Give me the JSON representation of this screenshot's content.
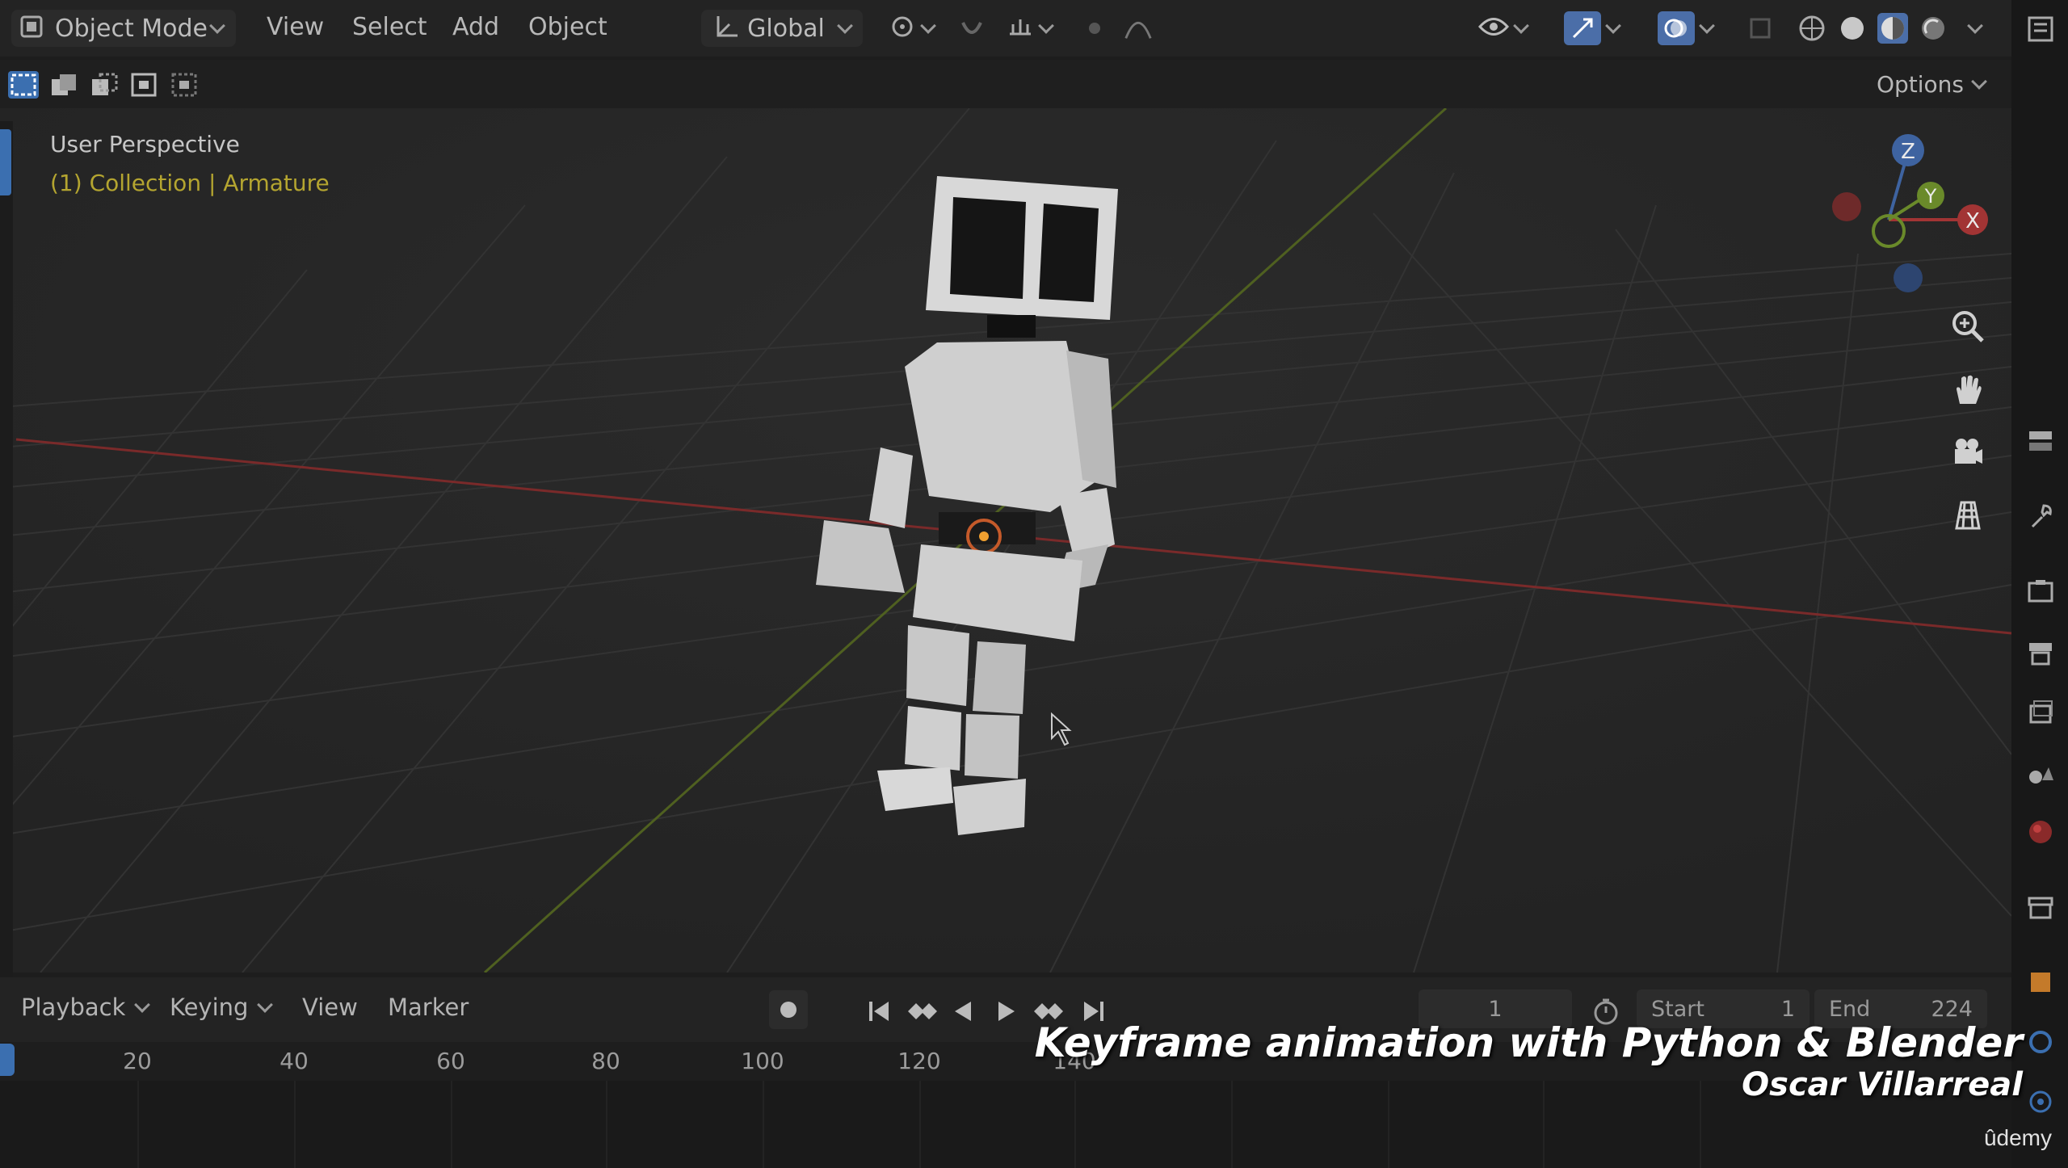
{
  "header": {
    "mode": "Object Mode",
    "menus": [
      "View",
      "Select",
      "Add",
      "Object"
    ],
    "transform_orientation": "Global",
    "options_label": "Options"
  },
  "viewport": {
    "title": "User Perspective",
    "subtitle": "(1) Collection | Armature",
    "gizmo": {
      "x_label": "X",
      "y_label": "Y",
      "z_label": "Z"
    }
  },
  "timeline": {
    "menus": [
      "Playback",
      "Keying",
      "View",
      "Marker"
    ],
    "current_frame": "1",
    "start_label": "Start",
    "start_value": "1",
    "end_label": "End",
    "end_value": "224",
    "ruler_ticks": [
      "20",
      "40",
      "60",
      "80",
      "100",
      "120",
      "140"
    ]
  },
  "overlay": {
    "course_title": "Keyframe animation with Python & Blender",
    "author": "Oscar Villarreal",
    "brand": "ûdemy"
  },
  "colors": {
    "accent_blue": "#3b6fb0",
    "axis_red": "#b03a3a",
    "axis_green": "#6c8a2a",
    "collection_text": "#b4a530"
  }
}
